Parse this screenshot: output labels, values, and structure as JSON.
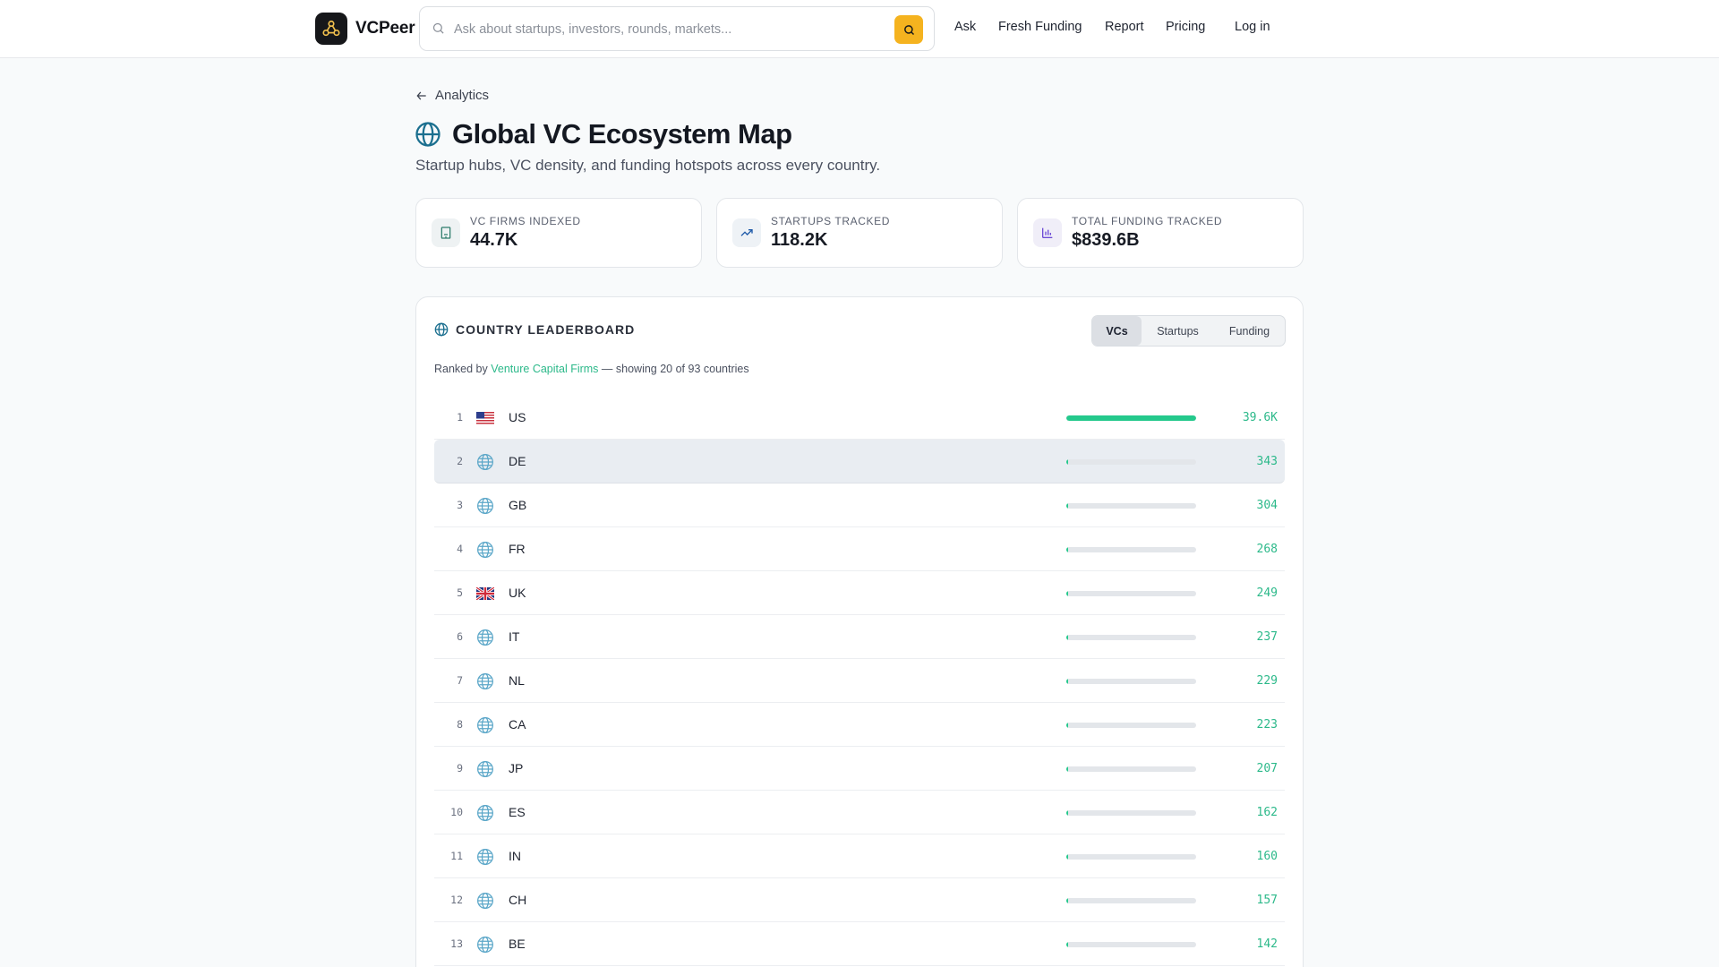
{
  "brand": {
    "name": "VCPeer"
  },
  "search": {
    "placeholder": "Ask about startups, investors, rounds, markets..."
  },
  "nav": {
    "ask": "Ask",
    "fresh_funding": "Fresh Funding",
    "report": "Report",
    "pricing": "Pricing",
    "login": "Log in"
  },
  "breadcrumb": {
    "back_label": "Analytics"
  },
  "page": {
    "title": "Global VC Ecosystem Map",
    "subtitle": "Startup hubs, VC density, and funding hotspots across every country."
  },
  "stats": [
    {
      "label": "VC FIRMS INDEXED",
      "value": "44.7K",
      "icon": "building-icon",
      "color": "#2e7d6b"
    },
    {
      "label": "STARTUPS TRACKED",
      "value": "118.2K",
      "icon": "trending-up-icon",
      "color": "#1e5aa8"
    },
    {
      "label": "TOTAL FUNDING TRACKED",
      "value": "$839.6B",
      "icon": "bar-chart-icon",
      "color": "#6d4bd6"
    }
  ],
  "leaderboard": {
    "title": "COUNTRY LEADERBOARD",
    "tabs": [
      "VCs",
      "Startups",
      "Funding"
    ],
    "active_tab": "VCs",
    "ranked_prefix": "Ranked by",
    "ranked_metric": "Venture Capital Firms",
    "ranked_suffix": "— showing 20 of 93 countries",
    "accent": "#24c98c",
    "rows": [
      {
        "rank": "1",
        "code": "US",
        "value": "39.6K",
        "num": 39600,
        "flag": "us"
      },
      {
        "rank": "2",
        "code": "DE",
        "value": "343",
        "num": 343,
        "flag": "globe"
      },
      {
        "rank": "3",
        "code": "GB",
        "value": "304",
        "num": 304,
        "flag": "globe"
      },
      {
        "rank": "4",
        "code": "FR",
        "value": "268",
        "num": 268,
        "flag": "globe"
      },
      {
        "rank": "5",
        "code": "UK",
        "value": "249",
        "num": 249,
        "flag": "uk"
      },
      {
        "rank": "6",
        "code": "IT",
        "value": "237",
        "num": 237,
        "flag": "globe"
      },
      {
        "rank": "7",
        "code": "NL",
        "value": "229",
        "num": 229,
        "flag": "globe"
      },
      {
        "rank": "8",
        "code": "CA",
        "value": "223",
        "num": 223,
        "flag": "globe"
      },
      {
        "rank": "9",
        "code": "JP",
        "value": "207",
        "num": 207,
        "flag": "globe"
      },
      {
        "rank": "10",
        "code": "ES",
        "value": "162",
        "num": 162,
        "flag": "globe"
      },
      {
        "rank": "11",
        "code": "IN",
        "value": "160",
        "num": 160,
        "flag": "globe"
      },
      {
        "rank": "12",
        "code": "CH",
        "value": "157",
        "num": 157,
        "flag": "globe"
      },
      {
        "rank": "13",
        "code": "BE",
        "value": "142",
        "num": 142,
        "flag": "globe"
      }
    ]
  }
}
